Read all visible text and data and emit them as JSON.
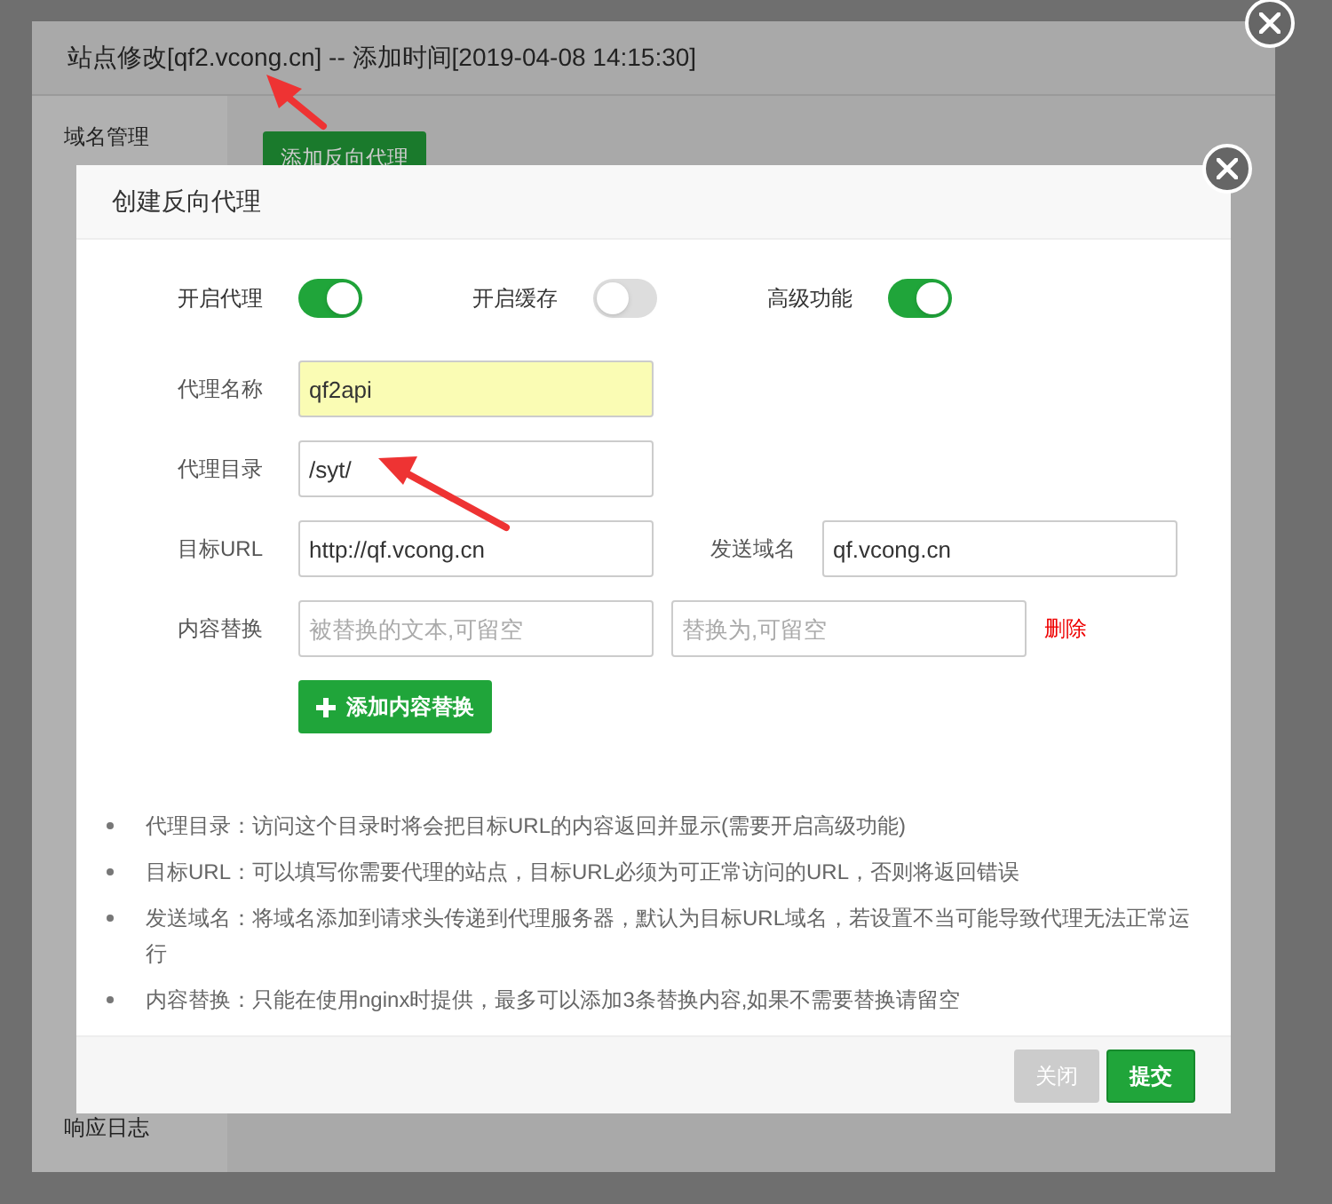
{
  "background_dialog": {
    "title": "站点修改[qf2.vcong.cn] -- 添加时间[2019-04-08 14:15:30]",
    "sidebar": [
      {
        "label": "域名管理"
      },
      {
        "label": "响应日志"
      }
    ],
    "add_button": "添加反向代理"
  },
  "dialog": {
    "title": "创建反向代理",
    "toggles": [
      {
        "label": "开启代理",
        "on": true
      },
      {
        "label": "开启缓存",
        "on": false
      },
      {
        "label": "高级功能",
        "on": true
      }
    ],
    "name_field": {
      "label": "代理名称",
      "value": "qf2api",
      "highlighted": true
    },
    "dir_field": {
      "label": "代理目录",
      "value": "/syt/",
      "highlighted": false
    },
    "url_field": {
      "label": "目标URL",
      "value": "http://qf.vcong.cn",
      "highlighted": false
    },
    "domain_field": {
      "label": "发送域名",
      "value": "qf.vcong.cn",
      "highlighted": false
    },
    "replace": {
      "label": "内容替换",
      "from_placeholder": "被替换的文本,可留空",
      "to_placeholder": "替换为,可留空",
      "delete": "删除"
    },
    "add_replace_button": "添加内容替换",
    "notes": [
      "代理目录：访问这个目录时将会把目标URL的内容返回并显示(需要开启高级功能)",
      "目标URL：可以填写你需要代理的站点，目标URL必须为可正常访问的URL，否则将返回错误",
      "发送域名：将域名添加到请求头传递到代理服务器，默认为目标URL域名，若设置不当可能导致代理无法正常运行",
      "内容替换：只能在使用nginx时提供，最多可以添加3条替换内容,如果不需要替换请留空"
    ],
    "buttons": [
      {
        "label": "关闭",
        "kind": "close"
      },
      {
        "label": "提交",
        "kind": "submit"
      }
    ]
  }
}
